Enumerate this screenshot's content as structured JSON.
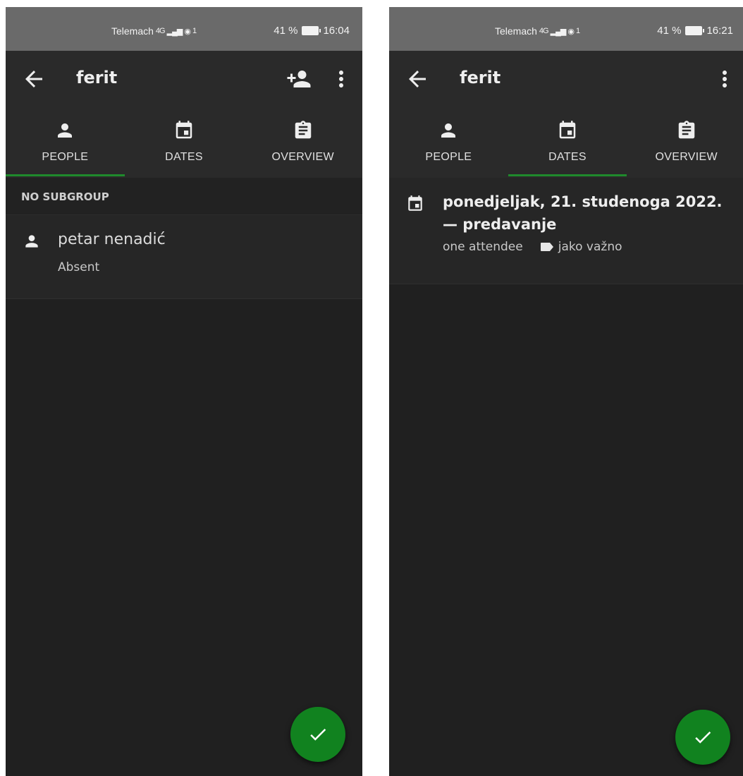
{
  "left_screen": {
    "status_bar": {
      "carrier": "Telemach",
      "network": "4G",
      "sim": "1",
      "battery": "41 %",
      "time": "16:04"
    },
    "app_bar": {
      "title": "ferit"
    },
    "tabs": [
      {
        "label": "PEOPLE",
        "icon": "person-icon",
        "selected": true
      },
      {
        "label": "DATES",
        "icon": "calendar-icon",
        "selected": false
      },
      {
        "label": "OVERVIEW",
        "icon": "clipboard-icon",
        "selected": false
      }
    ],
    "subgroup": {
      "label": "NO SUBGROUP"
    },
    "people": [
      {
        "name": "petar nenadić",
        "status": "Absent"
      }
    ],
    "fab_icon": "check-icon"
  },
  "right_screen": {
    "status_bar": {
      "carrier": "Telemach",
      "network": "4G",
      "sim": "1",
      "battery": "41 %",
      "time": "16:21"
    },
    "app_bar": {
      "title": "ferit"
    },
    "tabs": [
      {
        "label": "PEOPLE",
        "icon": "person-icon",
        "selected": false
      },
      {
        "label": "DATES",
        "icon": "calendar-icon",
        "selected": true
      },
      {
        "label": "OVERVIEW",
        "icon": "clipboard-icon",
        "selected": false
      }
    ],
    "dates": [
      {
        "title": "ponedjeljak, 21. studenoga 2022. — predavanje",
        "attendees": "one attendee",
        "tag": "jako važno"
      }
    ],
    "fab_icon": "check-icon"
  },
  "colors": {
    "accent": "#1f8a2c",
    "fab": "#11821f",
    "app_bar": "#2a2a2a",
    "background": "#202020",
    "status_bar": "#6a6a6a"
  }
}
